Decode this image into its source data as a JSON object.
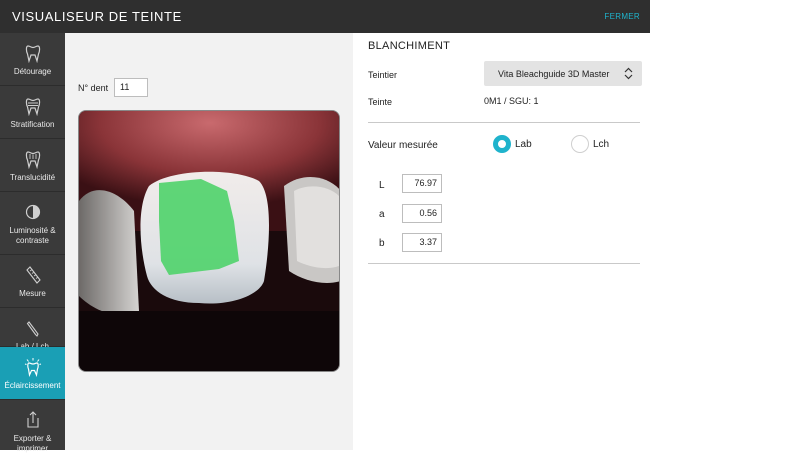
{
  "header": {
    "title": "VISUALISEUR DE TEINTE",
    "close_label": "FERMER"
  },
  "sidebar": {
    "items": [
      {
        "label": "Détourage",
        "icon": "tooth-icon",
        "active": false
      },
      {
        "label": "Stratification",
        "icon": "tooth-layers-icon",
        "active": false
      },
      {
        "label": "Translucidité",
        "icon": "tooth-translucency-icon",
        "active": false
      },
      {
        "label": "Luminosité & contraste",
        "icon": "contrast-icon",
        "active": false
      },
      {
        "label": "Mesure",
        "icon": "ruler-icon",
        "active": false
      },
      {
        "label": "Lab / Lch",
        "icon": "pen-icon",
        "active": false
      },
      {
        "label": "Éclaircissement",
        "icon": "tooth-sparkle-icon",
        "active": true
      },
      {
        "label": "Exporter & imprimer",
        "icon": "share-icon",
        "active": false
      }
    ]
  },
  "left": {
    "dent_label": "N° dent",
    "dent_value": "11"
  },
  "right": {
    "section_title": "BLANCHIMENT",
    "teintier_label": "Teintier",
    "teintier_value": "Vita Bleachguide 3D Master",
    "teinte_label": "Teinte",
    "teinte_value": "0M1 / SGU: 1",
    "valeur_label": "Valeur mesurée",
    "mode_options": [
      "Lab",
      "Lch"
    ],
    "mode_selected": "Lab",
    "lab": [
      {
        "label": "L",
        "value": "76.97"
      },
      {
        "label": "a",
        "value": "0.56"
      },
      {
        "label": "b",
        "value": "3.37"
      }
    ]
  },
  "colors": {
    "accent": "#1fb3cc",
    "active_nav": "#1a9fb5",
    "overlay": "#4fd36a"
  }
}
